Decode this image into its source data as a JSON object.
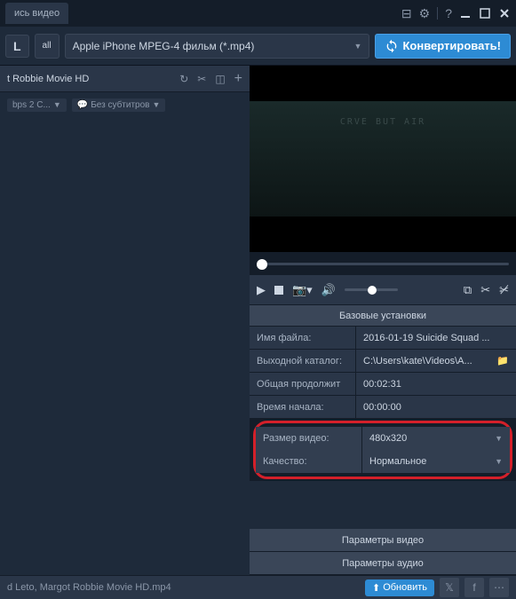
{
  "titlebar": {
    "tab": "ись видео"
  },
  "formatbar": {
    "badge": "L",
    "profile_icon": "all",
    "profile_label": "Apple iPhone MPEG-4 фильм (*.mp4)",
    "convert_label": "Конвертировать!"
  },
  "item": {
    "title": "t Robbie Movie HD",
    "sub_codec": "bps 2 C...",
    "sub_subtitle": "Без субтитров"
  },
  "settings": {
    "header": "Базовые установки",
    "rows": {
      "filename": {
        "label": "Имя файла:",
        "value": "2016-01-19 Suicide Squad ..."
      },
      "outdir": {
        "label": "Выходной каталог:",
        "value": "C:\\Users\\kate\\Videos\\A..."
      },
      "duration": {
        "label": "Общая продолжит",
        "value": "00:02:31"
      },
      "start": {
        "label": "Время начала:",
        "value": "00:00:00"
      },
      "size": {
        "label": "Размер видео:",
        "value": "480x320"
      },
      "quality": {
        "label": "Качество:",
        "value": "Нормальное"
      }
    },
    "video_params": "Параметры видео",
    "audio_params": "Параметры аудио"
  },
  "footer": {
    "text": "d Leto, Margot Robbie Movie HD.mp4",
    "update": "Обновить"
  }
}
